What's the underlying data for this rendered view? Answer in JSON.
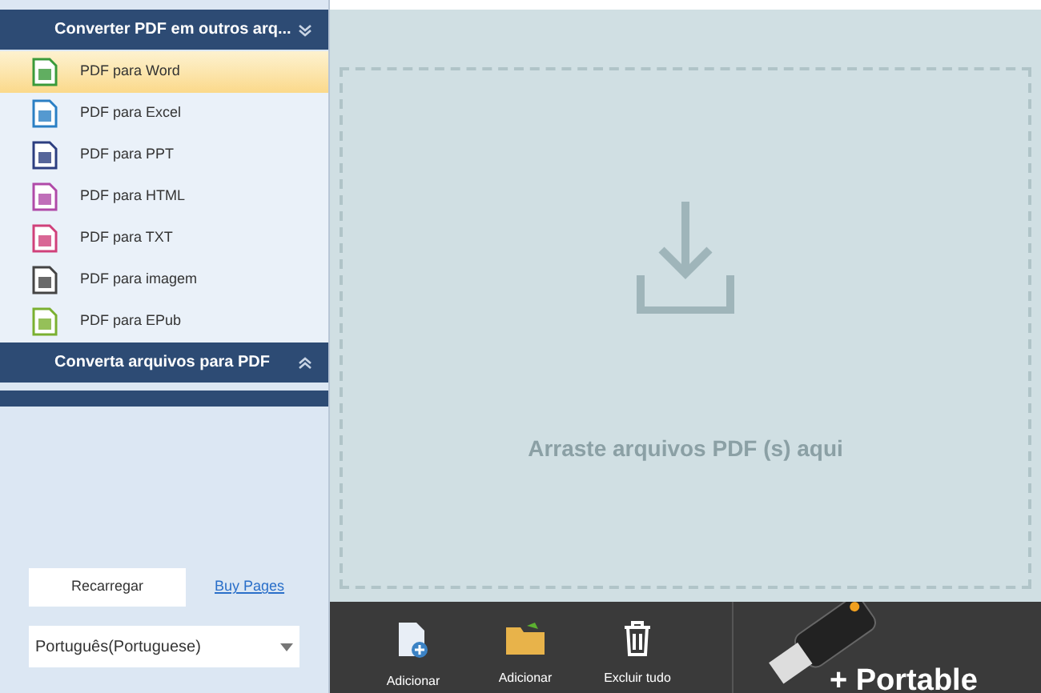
{
  "sidebar": {
    "sections": [
      {
        "title": "Converter PDF em outros arq...",
        "expanded": true,
        "items": [
          {
            "label": "PDF para Word",
            "kind": "word",
            "selected": true
          },
          {
            "label": "PDF para Excel",
            "kind": "excel",
            "selected": false
          },
          {
            "label": "PDF para PPT",
            "kind": "ppt",
            "selected": false
          },
          {
            "label": "PDF para HTML",
            "kind": "html",
            "selected": false
          },
          {
            "label": "PDF para TXT",
            "kind": "txt",
            "selected": false
          },
          {
            "label": "PDF para imagem",
            "kind": "image",
            "selected": false
          },
          {
            "label": "PDF para EPub",
            "kind": "epub",
            "selected": false
          }
        ]
      },
      {
        "title": "Converta arquivos para PDF",
        "expanded": false
      }
    ],
    "reload_button": "Recarregar",
    "buy_link": "Buy Pages",
    "language": "Português(Portuguese)"
  },
  "drop_zone": {
    "text": "Arraste arquivos PDF (s) aqui"
  },
  "toolbar": {
    "buttons": [
      {
        "label": "Adicionar",
        "kind": "file"
      },
      {
        "label": "Adicionar",
        "kind": "folder"
      },
      {
        "label": "Excluir tudo",
        "kind": "trash"
      }
    ],
    "promo": "+ Portable"
  }
}
